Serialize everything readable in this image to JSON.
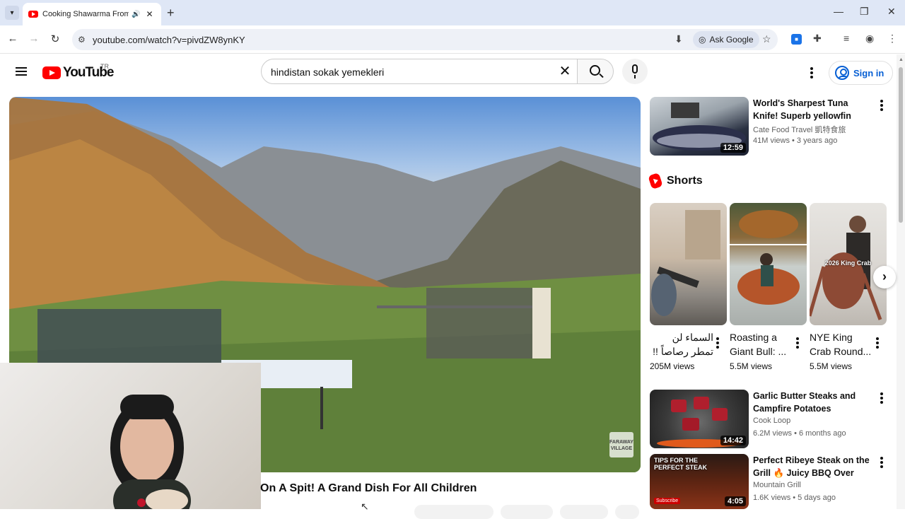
{
  "browser": {
    "tab_title": "Cooking Shawarma From A",
    "tab_audio_icon": "speaker-icon",
    "new_tab_label": "+",
    "url": "youtube.com/watch?v=pivdZW8ynKY",
    "ask_google_label": "Ask Google"
  },
  "header": {
    "logo_text": "YouTube",
    "country_code": "TR",
    "search_query": "hindistan sokak yemekleri",
    "signin_label": "Sign in"
  },
  "player": {
    "watermark": "FARAWAY VILLAGE",
    "video_title_partial": "On A Spit! A Grand Dish For All Children"
  },
  "recommendations": [
    {
      "title": "World's Sharpest Tuna Knife! Superb yellowfin Tuna cutting ...",
      "channel": "Cate Food Travel 凱特食旅",
      "meta": "41M views • 3 years ago",
      "duration": "12:59"
    },
    {
      "title": "Garlic Butter Steaks and Campfire Potatoes Outdoors",
      "channel": "Cook Loop",
      "meta": "6.2M views • 6 months ago",
      "duration": "14:42"
    },
    {
      "title": "Perfect Ribeye Steak on the Grill 🔥 Juicy BBQ Over Open Fire ...",
      "channel": "Mountain Grill",
      "meta": "1.6K views • 5 days ago",
      "duration": "4:05",
      "thumb_text": "TIPS FOR THE PERFECT STEAK",
      "thumb_badge": "Subscribe"
    }
  ],
  "shorts": {
    "heading": "Shorts",
    "items": [
      {
        "title": "السماء لن تمطر رصاصاً !!",
        "views": "205M views"
      },
      {
        "title": "Roasting a Giant Bull: ...",
        "views": "5.5M views"
      },
      {
        "title": "NYE King Crab Round...",
        "views": "5.5M views",
        "thumb_label": "2026 King Crab"
      }
    ]
  },
  "colors": {
    "brand_red": "#ff0000",
    "link_blue": "#065fd4",
    "chrome_tabbar": "#dfe7f6"
  }
}
